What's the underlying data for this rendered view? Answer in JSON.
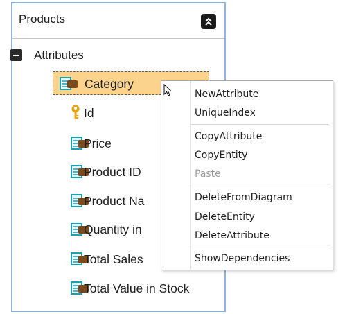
{
  "panel": {
    "title": "Products",
    "collapse_icon": "chevron-double-up-icon"
  },
  "group": {
    "label": "Attributes",
    "toggle_icon": "minus-icon"
  },
  "attributes": [
    {
      "label": "Category",
      "icon": "attribute-icon",
      "selected": true
    },
    {
      "label": "Id",
      "icon": "key-icon"
    },
    {
      "label": "Price",
      "icon": "attribute-icon"
    },
    {
      "label": "Product ID",
      "icon": "attribute-icon"
    },
    {
      "label": "Product Na",
      "icon": "attribute-icon"
    },
    {
      "label": "Quantity in",
      "icon": "attribute-icon"
    },
    {
      "label": "Total Sales",
      "icon": "attribute-icon"
    },
    {
      "label": "Total Value in Stock",
      "icon": "attribute-icon"
    }
  ],
  "context_menu": {
    "items": [
      {
        "label": "NewAttribute"
      },
      {
        "label": "UniqueIndex"
      },
      {
        "label": "CopyAttribute"
      },
      {
        "label": "CopyEntity"
      },
      {
        "label": "Paste",
        "disabled": true
      },
      {
        "label": "DeleteFromDiagram"
      },
      {
        "label": "DeleteEntity"
      },
      {
        "label": "DeleteAttribute"
      },
      {
        "label": "ShowDependencies"
      }
    ]
  },
  "colors": {
    "selection": "#fcd38c",
    "panel_border": "#8fb4d8",
    "icon_teal": "#1a9fb5",
    "icon_brown": "#7a4a1c",
    "key_gold": "#e8a317"
  }
}
